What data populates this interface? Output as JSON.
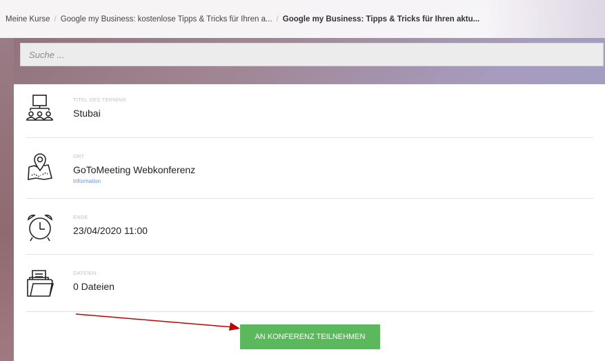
{
  "breadcrumb": {
    "items": [
      "Meine Kurse",
      "Google my Business: kostenlose Tipps & Tricks für Ihren a...",
      "Google my Business: Tipps & Tricks für Ihren aktu..."
    ]
  },
  "search": {
    "placeholder": "Suche ..."
  },
  "event": {
    "title_label": "TITEL DES TERMINS",
    "title_value": "Stubai",
    "location_label": "ORT",
    "location_value": "GoToMeeting Webkonferenz",
    "location_link": "Information",
    "end_label": "ENDE",
    "end_value": "23/04/2020 11:00",
    "files_label": "DATEIEN",
    "files_value": "0 Dateien"
  },
  "actions": {
    "join_label": "AN KONFERENZ TEILNEHMEN"
  },
  "colors": {
    "button": "#5cb85c",
    "link": "#6a8fd4",
    "arrow": "#c00000"
  },
  "icons": [
    "presentation-audience-icon",
    "map-pin-icon",
    "alarm-clock-icon",
    "document-folder-icon"
  ]
}
